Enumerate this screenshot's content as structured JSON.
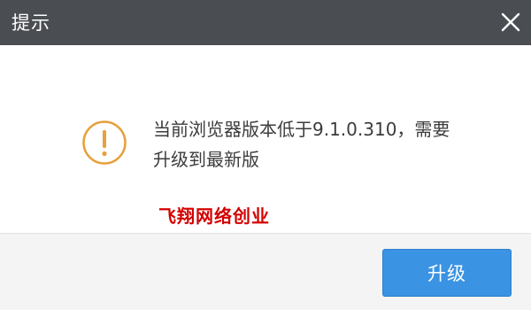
{
  "dialog": {
    "title": "提示",
    "message_line1": "当前浏览器版本低于9.1.0.310，需要",
    "message_line2": "升级到最新版",
    "watermark": "飞翔网络创业",
    "upgrade_label": "升级"
  },
  "icons": {
    "close": "close-icon",
    "warning": "warning-icon"
  },
  "colors": {
    "titlebar": "#4a4d52",
    "warning": "#e6a03c",
    "primary": "#3a93e3",
    "watermark": "#d40000"
  }
}
